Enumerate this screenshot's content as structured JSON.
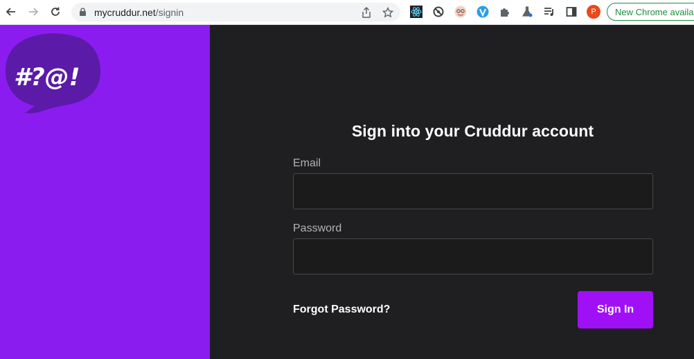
{
  "browser": {
    "url_domain": "mycruddur.net",
    "url_path": "/signin",
    "profile_initial": "P",
    "new_chrome_label": "New Chrome available",
    "extension_icons": [
      "react-devtools-icon",
      "sync-icon",
      "avatar-extension-icon",
      "vimium-icon",
      "puzzle-icon",
      "flask-icon",
      "media-queue-icon",
      "sidepanel-icon"
    ]
  },
  "brand": {
    "logo_text": "#?@!",
    "logo_color": "#5b1aa8",
    "panel_color": "#8b1cf0"
  },
  "signin": {
    "title": "Sign into your Cruddur account",
    "email_label": "Email",
    "email_value": "",
    "password_label": "Password",
    "password_value": "",
    "forgot_label": "Forgot Password?",
    "submit_label": "Sign In",
    "accent": "#a010f6"
  }
}
